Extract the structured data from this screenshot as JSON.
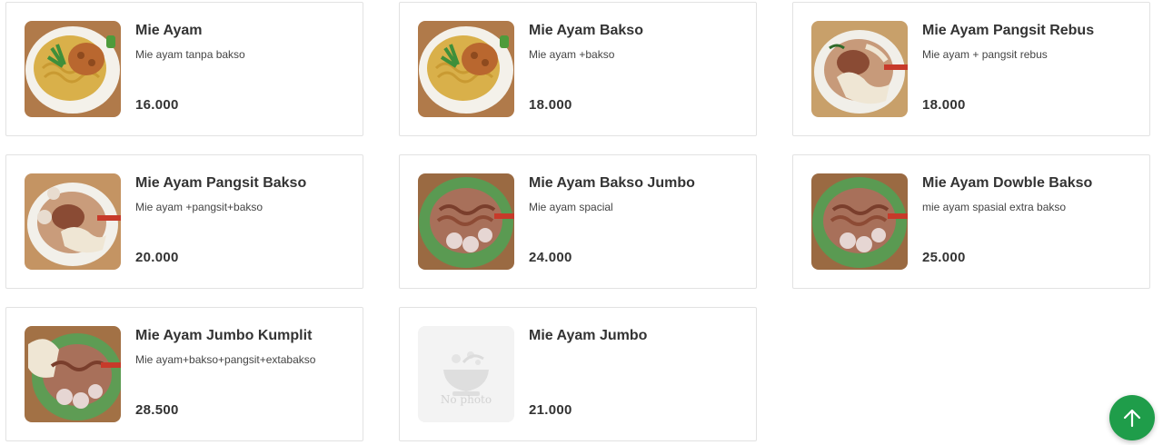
{
  "menu_items": [
    {
      "name": "Mie Ayam",
      "description": "Mie ayam tanpa bakso",
      "price": "16.000",
      "photo": "mie-ayam"
    },
    {
      "name": "Mie Ayam Bakso",
      "description": "Mie ayam +bakso",
      "price": "18.000",
      "photo": "mie-ayam"
    },
    {
      "name": "Mie Ayam Pangsit Rebus",
      "description": "Mie ayam + pangsit rebus",
      "price": "18.000",
      "photo": "pangsit"
    },
    {
      "name": "Mie Ayam Pangsit Bakso",
      "description": "Mie ayam +pangsit+bakso",
      "price": "20.000",
      "photo": "pangsit-bakso"
    },
    {
      "name": "Mie Ayam Bakso Jumbo",
      "description": "Mie ayam spacial",
      "price": "24.000",
      "photo": "bakso-bowl"
    },
    {
      "name": "Mie Ayam Dowble Bakso",
      "description": "mie ayam spasial extra bakso",
      "price": "25.000",
      "photo": "bakso-bowl"
    },
    {
      "name": "Mie Ayam Jumbo Kumplit",
      "description": "Mie ayam+bakso+pangsit+extabakso",
      "price": "28.500",
      "photo": "kumplit"
    },
    {
      "name": "Mie Ayam Jumbo",
      "description": "",
      "price": "21.000",
      "photo": "none",
      "placeholder_text": "No photo"
    }
  ],
  "scroll_top_button": {
    "icon": "arrow-up-icon",
    "color": "#1f9d4a"
  },
  "colors": {
    "card_border": "#e2e2e2",
    "text": "#333333",
    "accent": "#1f9d4a"
  }
}
